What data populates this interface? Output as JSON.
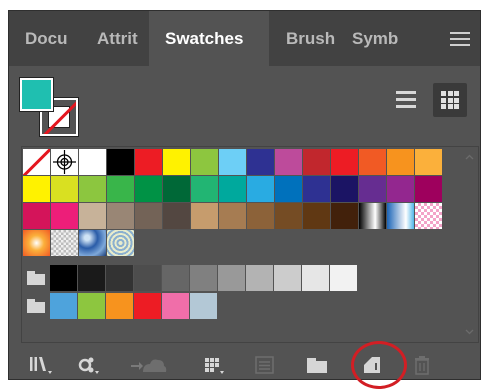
{
  "tabs": [
    {
      "label": "Docu",
      "active": false
    },
    {
      "label": "Attrit",
      "active": false
    },
    {
      "label": "Swatches",
      "active": true
    },
    {
      "label": "Brush",
      "active": false
    },
    {
      "label": "Symb",
      "active": false
    }
  ],
  "colors": {
    "panel_bg": "#535353",
    "tabbar_bg": "#424242",
    "fill_color": "#1fbfb0",
    "highlight_circle": "#d21e24"
  },
  "fill_stroke": {
    "fill_icon": "teal-fill-swatch-icon",
    "stroke_icon": "none-stroke-icon"
  },
  "view_buttons": [
    {
      "icon": "list-view-icon",
      "active": false
    },
    {
      "icon": "thumbnail-view-icon",
      "active": true
    }
  ],
  "swatch_rows": [
    [
      "none",
      "registration",
      "#ffffff",
      "#000000",
      "#ed1c24",
      "#fff200",
      "#8dc63f",
      "#6dcff6",
      "#2e3192",
      "#bd4b9b",
      "#c1272d",
      "#ed1c24",
      "#f15a24",
      "#f7931e",
      "#fbb03b"
    ],
    [
      "#fff200",
      "#d9e021",
      "#8cc63f",
      "#39b54a",
      "#009245",
      "#006837",
      "#22b573",
      "#00a99d",
      "#29abe2",
      "#0071bc",
      "#2e3192",
      "#1b1464",
      "#662d91",
      "#93278f",
      "#9e005d"
    ],
    [
      "#d4145a",
      "#ed1e79",
      "#c7b299",
      "#998675",
      "#736357",
      "#534741",
      "#c69c6d",
      "#a67c52",
      "#8c6239",
      "#754c24",
      "#603813",
      "#42210b",
      "gradient-black-white",
      "gradient-blue",
      "pattern-pink-checker"
    ],
    [
      "gradient-orange-radial",
      "pattern-gray-dots",
      "pattern-blue-swirl",
      "pattern-blue-scales"
    ],
    [
      "folder",
      "#000000",
      "#1a1a1a",
      "#333333",
      "#4d4d4d",
      "#666666",
      "#808080",
      "#999999",
      "#b3b3b3",
      "#cccccc",
      "#e6e6e6",
      "#f2f2f2"
    ],
    [
      "folder",
      "#4ea3dc",
      "#8dc63f",
      "#f7931e",
      "#ed1c24",
      "#f06ea9",
      "#b3c8d6"
    ]
  ],
  "bottom_buttons": [
    {
      "icon": "swatch-libraries-menu-icon"
    },
    {
      "icon": "place-swatch-instances-icon"
    },
    {
      "icon": "cc-library-icon"
    },
    {
      "icon": "show-swatch-kinds-menu-icon"
    },
    {
      "icon": "swatch-options-icon"
    },
    {
      "icon": "new-color-group-icon"
    },
    {
      "icon": "new-swatch-icon"
    },
    {
      "icon": "trash-icon"
    }
  ]
}
